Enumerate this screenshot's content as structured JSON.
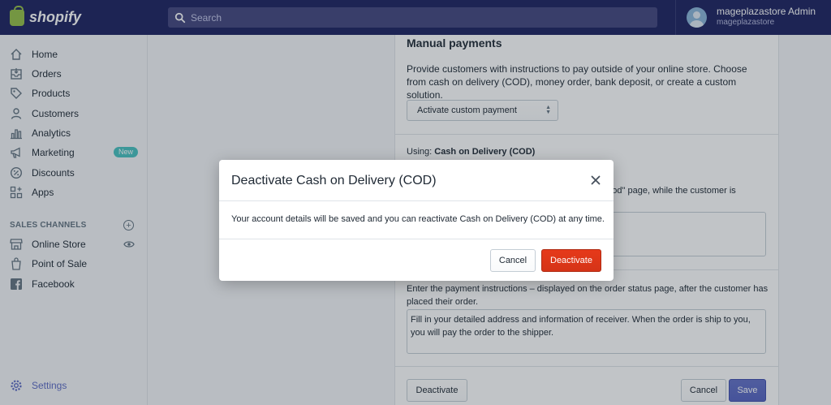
{
  "brand": {
    "name": "shopify"
  },
  "search": {
    "placeholder": "Search"
  },
  "user": {
    "name": "mageplazastore Admin",
    "store": "mageplazastore"
  },
  "sidebar": {
    "items": [
      {
        "label": "Home",
        "icon": "home-icon"
      },
      {
        "label": "Orders",
        "icon": "orders-icon"
      },
      {
        "label": "Products",
        "icon": "tag-icon"
      },
      {
        "label": "Customers",
        "icon": "person-icon"
      },
      {
        "label": "Analytics",
        "icon": "bar-chart-icon"
      },
      {
        "label": "Marketing",
        "icon": "megaphone-icon",
        "badge": "New"
      },
      {
        "label": "Discounts",
        "icon": "discount-icon"
      },
      {
        "label": "Apps",
        "icon": "apps-icon"
      }
    ],
    "sales_channels_title": "SALES CHANNELS",
    "channels": [
      {
        "label": "Online Store",
        "icon": "store-icon"
      },
      {
        "label": "Point of Sale",
        "icon": "pos-bag-icon"
      },
      {
        "label": "Facebook",
        "icon": "facebook-icon"
      }
    ],
    "settings_label": "Settings"
  },
  "main": {
    "title": "Manual payments",
    "description": "Provide customers with instructions to pay outside of your online store. Choose from cash on delivery (COD), money order, bank deposit, or create a custom solution.",
    "select_value": "Activate custom payment",
    "using_label": "Using:",
    "using_value": "Cash on Delivery (COD)",
    "partial_text": "ethod\" page, while the customer is",
    "instructions_label": "Enter the payment instructions – displayed on the order status page, after the customer has placed their order.",
    "instructions_value": "Fill in your detailed address and information of receiver. When the order is ship to you, you will pay the order to the shipper.",
    "deactivate_label": "Deactivate",
    "cancel_label": "Cancel",
    "save_label": "Save"
  },
  "modal": {
    "title": "Deactivate Cash on Delivery (COD)",
    "body": "Your account details will be saved and you can reactivate Cash on Delivery (COD) at any time.",
    "cancel_label": "Cancel",
    "deactivate_label": "Deactivate"
  },
  "colors": {
    "topbar": "#1c2260",
    "accent": "#5c6ac4",
    "danger": "#de3618",
    "badge": "#47c1bf"
  }
}
